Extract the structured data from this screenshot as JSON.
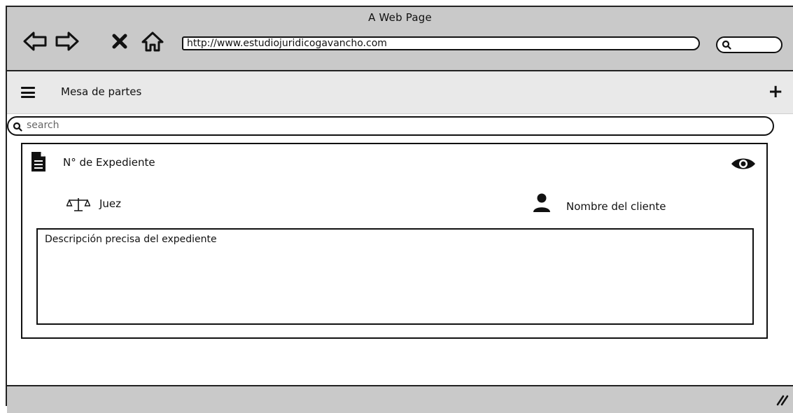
{
  "window": {
    "title": "A Web Page",
    "url": "http://www.estudiojuridicogavancho.com"
  },
  "navigation": {
    "icons": [
      "back-arrow-icon",
      "forward-arrow-icon",
      "close-x-icon",
      "home-icon"
    ]
  },
  "appbar": {
    "title": "Mesa de partes",
    "menu_icon": "hamburger-icon",
    "add_icon": "plus-icon",
    "add_label": "+"
  },
  "search": {
    "placeholder": "search"
  },
  "card": {
    "expediente_label": "N° de Expediente",
    "juez_label": "Juez",
    "cliente_label": "Nombre del cliente",
    "description": "Descripción precisa del expediente",
    "icons": [
      "document-icon",
      "eye-icon",
      "scale-icon",
      "person-icon"
    ]
  },
  "colors": {
    "chrome": "#c9c9c9",
    "appbar": "#e9e9e9",
    "stroke": "#111111"
  }
}
